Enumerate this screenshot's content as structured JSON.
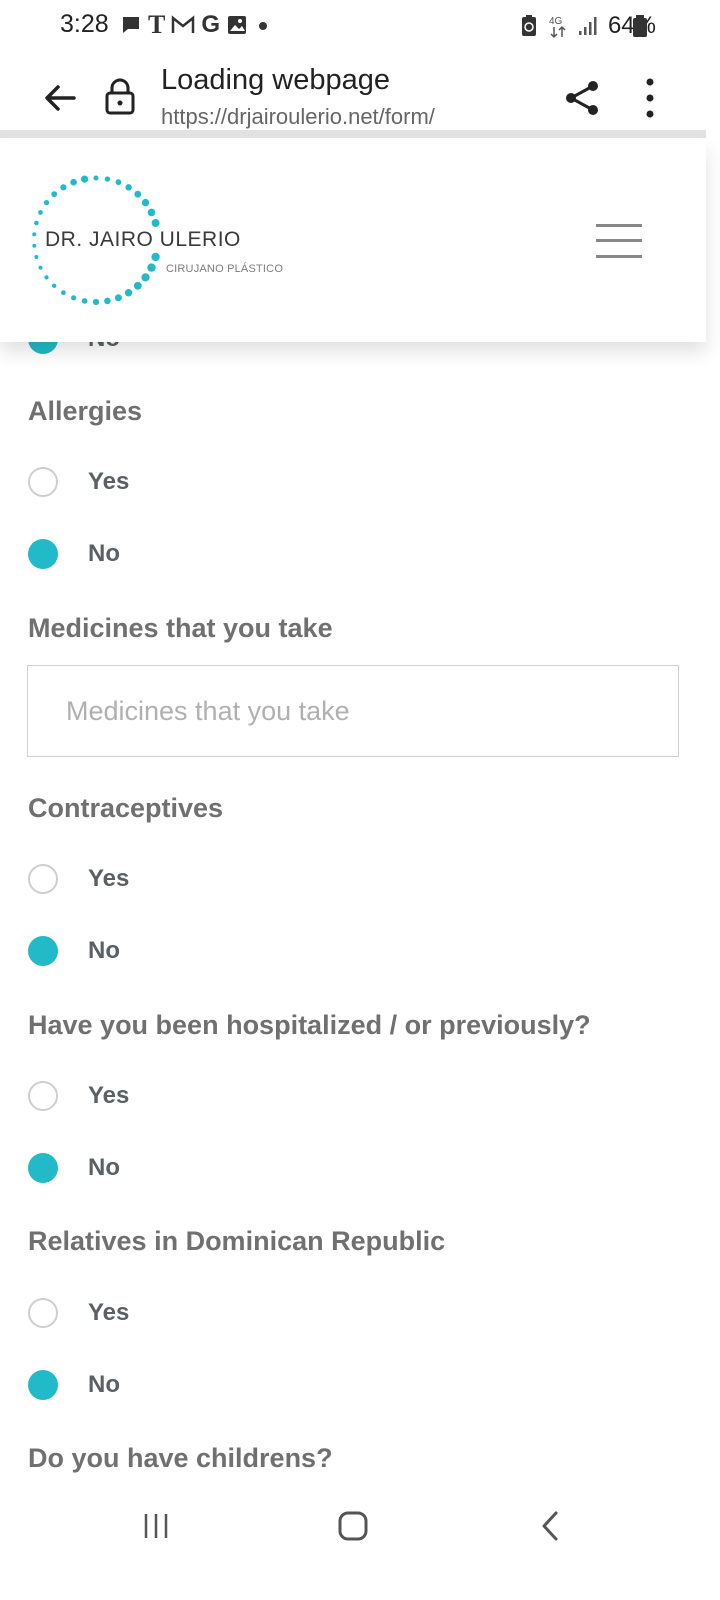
{
  "status_bar": {
    "time": "3:28",
    "battery": "64%",
    "notification_icons": [
      "chat-bubble-icon",
      "t-mobile-icon",
      "gmail-icon",
      "google-icon",
      "gallery-icon",
      "dot-icon"
    ],
    "right_icons": [
      "battery-saver-icon",
      "data-4g-icon",
      "signal-icon",
      "battery-icon"
    ],
    "carrier_t": "T",
    "google_g": "G",
    "data_type": "4G"
  },
  "browser": {
    "title": "Loading webpage",
    "url": "https://drjairoulerio.net/form/"
  },
  "site": {
    "brand_name": "DR. JAIRO ULERIO",
    "brand_subtitle": "CIRUJANO PLÁSTICO",
    "accent_color": "#22b9c8"
  },
  "form": {
    "partial_option": "No",
    "questions": [
      {
        "label": "Allergies",
        "options": [
          "Yes",
          "No"
        ],
        "selected": "No"
      },
      {
        "label": "Medicines that you take",
        "placeholder": "Medicines that you take",
        "value": ""
      },
      {
        "label": "Contraceptives",
        "options": [
          "Yes",
          "No"
        ],
        "selected": "No"
      },
      {
        "label": "Have you been hospitalized / or previously?",
        "options": [
          "Yes",
          "No"
        ],
        "selected": "No"
      },
      {
        "label": "Relatives in Dominican Republic",
        "options": [
          "Yes",
          "No"
        ],
        "selected": "No"
      },
      {
        "label": "Do you have childrens?"
      }
    ]
  }
}
